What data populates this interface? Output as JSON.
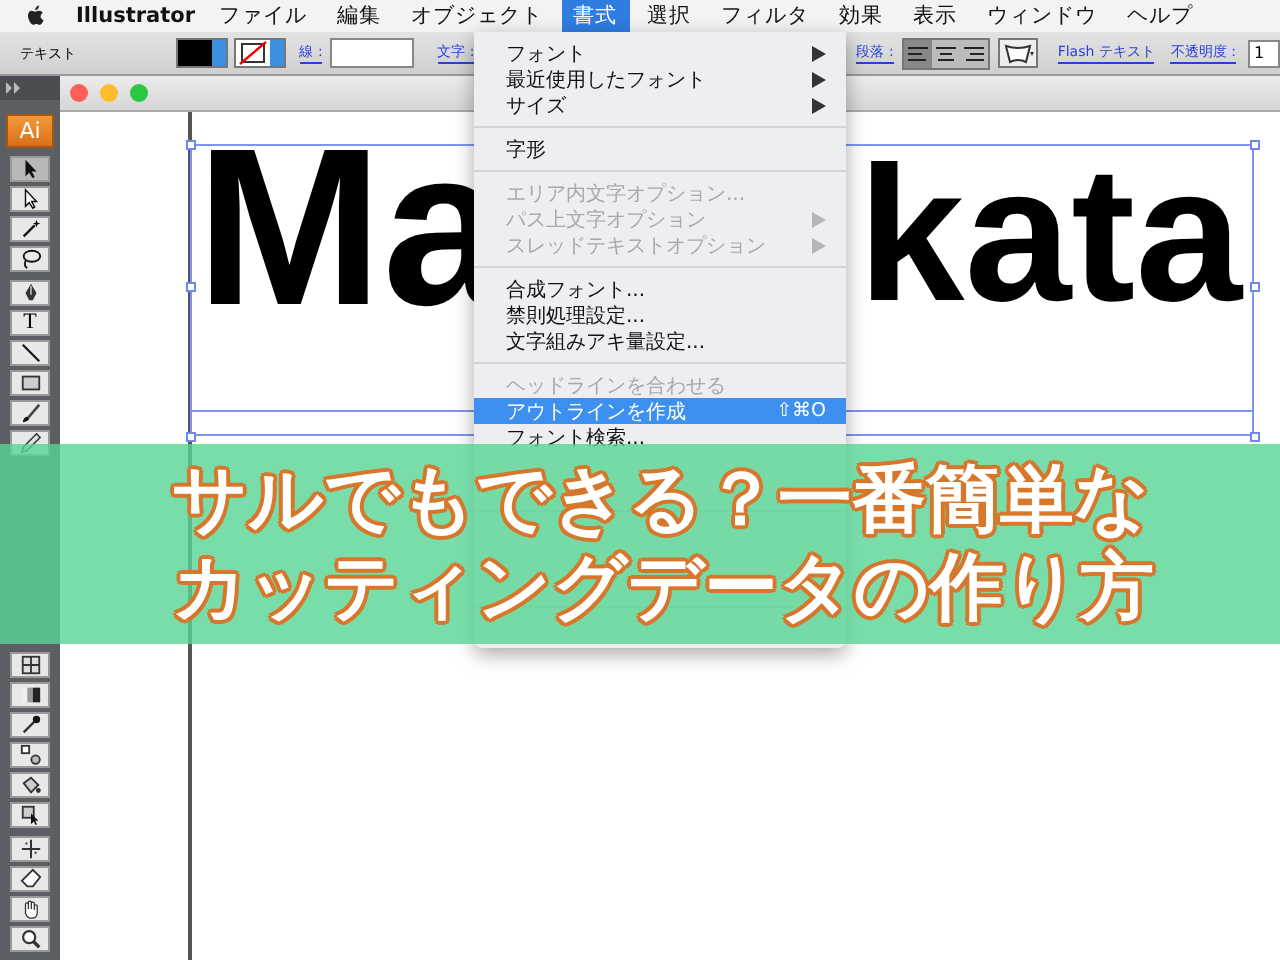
{
  "menubar": {
    "app": "Illustrator",
    "menus": [
      {
        "label": "ファイル",
        "selected": false
      },
      {
        "label": "編集",
        "selected": false
      },
      {
        "label": "オブジェクト",
        "selected": false
      },
      {
        "label": "書式",
        "selected": true
      },
      {
        "label": "選択",
        "selected": false
      },
      {
        "label": "フィルタ",
        "selected": false
      },
      {
        "label": "効果",
        "selected": false
      },
      {
        "label": "表示",
        "selected": false
      },
      {
        "label": "ウィンドウ",
        "selected": false
      },
      {
        "label": "ヘルプ",
        "selected": false
      }
    ]
  },
  "control_bar": {
    "tool_label": "テキスト",
    "stroke_label": "線 :",
    "character_label": "文字 :",
    "paragraph_label": "段落 :",
    "align_buttons": [
      {
        "kind": "left",
        "selected": true
      },
      {
        "kind": "center",
        "selected": false
      },
      {
        "kind": "right",
        "selected": false
      }
    ],
    "flash_text_link": "Flash テキスト",
    "opacity_label": "不透明度 :",
    "opacity_value": "1"
  },
  "tools_panel": {
    "logo": "Ai",
    "groups": [
      [
        {
          "kind": "selection",
          "selected": true
        },
        {
          "kind": "direct",
          "selected": false
        },
        {
          "kind": "wand",
          "selected": false
        },
        {
          "kind": "lasso",
          "selected": false
        }
      ],
      [
        {
          "kind": "pen",
          "selected": false
        },
        {
          "kind": "type",
          "label": "T",
          "selected": false
        },
        {
          "kind": "line",
          "selected": false
        },
        {
          "kind": "rect",
          "selected": false
        },
        {
          "kind": "brush",
          "selected": false
        },
        {
          "kind": "pencil",
          "selected": false
        }
      ],
      [
        {
          "kind": "covered"
        },
        {
          "kind": "covered"
        },
        {
          "kind": "covered"
        },
        {
          "kind": "covered"
        }
      ],
      [
        {
          "kind": "covered"
        },
        {
          "kind": "covered"
        }
      ],
      [
        {
          "kind": "mesh",
          "selected": false
        },
        {
          "kind": "gradient",
          "selected": false
        },
        {
          "kind": "eyedropper",
          "selected": false
        },
        {
          "kind": "blend",
          "selected": false
        },
        {
          "kind": "bucket",
          "selected": false
        },
        {
          "kind": "paintselect",
          "selected": false
        }
      ],
      [
        {
          "kind": "slice",
          "selected": false
        },
        {
          "kind": "eraser",
          "selected": false
        },
        {
          "kind": "hand",
          "selected": false
        },
        {
          "kind": "zoom",
          "selected": false
        }
      ]
    ]
  },
  "canvas": {
    "text_left": "Ma",
    "text_right": "kata"
  },
  "dropdown_menu": {
    "items": [
      {
        "kind": "item",
        "label": "フォント",
        "submenu": true,
        "disabled": false,
        "selected": false
      },
      {
        "kind": "item",
        "label": "最近使用したフォント",
        "submenu": true,
        "disabled": false,
        "selected": false
      },
      {
        "kind": "item",
        "label": "サイズ",
        "submenu": true,
        "disabled": false,
        "selected": false
      },
      {
        "kind": "separator"
      },
      {
        "kind": "item",
        "label": "字形",
        "submenu": false,
        "disabled": false,
        "selected": false
      },
      {
        "kind": "separator"
      },
      {
        "kind": "item",
        "label": "エリア内文字オプション...",
        "submenu": false,
        "disabled": true,
        "selected": false
      },
      {
        "kind": "item",
        "label": "パス上文字オプション",
        "submenu": true,
        "disabled": true,
        "selected": false
      },
      {
        "kind": "item",
        "label": "スレッドテキストオプション",
        "submenu": true,
        "disabled": true,
        "selected": false
      },
      {
        "kind": "separator"
      },
      {
        "kind": "item",
        "label": "合成フォント...",
        "submenu": false,
        "disabled": false,
        "selected": false
      },
      {
        "kind": "item",
        "label": "禁則処理設定...",
        "submenu": false,
        "disabled": false,
        "selected": false
      },
      {
        "kind": "item",
        "label": "文字組みアキ量設定...",
        "submenu": false,
        "disabled": false,
        "selected": false
      },
      {
        "kind": "separator"
      },
      {
        "kind": "item",
        "label": "ヘッドラインを合わせる",
        "submenu": false,
        "disabled": true,
        "selected": false
      },
      {
        "kind": "item",
        "label": "アウトラインを作成",
        "shortcut": "⇧⌘O",
        "submenu": false,
        "disabled": false,
        "selected": true
      },
      {
        "kind": "item",
        "label": "フォント検索...",
        "submenu": false,
        "disabled": false,
        "selected": false
      },
      {
        "kind": "covered"
      },
      {
        "kind": "covered"
      },
      {
        "kind": "separator"
      },
      {
        "kind": "covered"
      },
      {
        "kind": "covered"
      },
      {
        "kind": "covered"
      },
      {
        "kind": "separator"
      },
      {
        "kind": "covered"
      }
    ]
  },
  "banner": {
    "lines": [
      "サルでもできる？一番簡単な",
      "カッティングデータの作り方"
    ]
  }
}
